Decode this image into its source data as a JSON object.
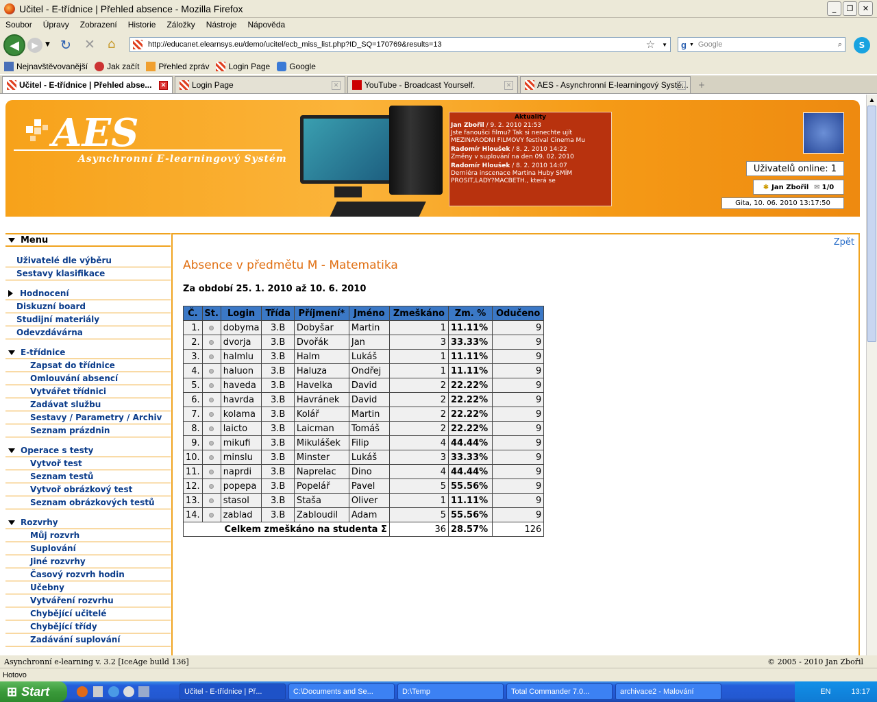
{
  "window": {
    "title": "Učitel - E-třídnice | Přehled absence - Mozilla Firefox"
  },
  "menu": [
    "Soubor",
    "Úpravy",
    "Zobrazení",
    "Historie",
    "Záložky",
    "Nástroje",
    "Nápověda"
  ],
  "url": "http://educanet.elearnsys.eu/demo/ucitel/ecb_miss_list.php?ID_SQ=170769&results=13",
  "search_placeholder": "Google",
  "bookmarks": [
    "Nejnavštěvovanější",
    "Jak začít",
    "Přehled zpráv",
    "Login Page",
    "Google"
  ],
  "tabs": [
    "Učitel - E-třídnice | Přehled abse...",
    "Login Page",
    "YouTube - Broadcast Yourself.",
    "AES - Asynchronní E-learningový Systé..."
  ],
  "header": {
    "logo": "AES",
    "subtitle": "Asynchronní E-learningový Systém",
    "news_title": "Aktuality",
    "news": [
      {
        "head": "Jan Zbořil",
        "meta": " / 9. 2. 2010 21:53",
        "text": "Jste fanoušci filmu? Tak si nenechte ujít MEZINARODNI FILMOVY festival Cinema Mu"
      },
      {
        "head": "Radomír Hloušek",
        "meta": " / 8. 2. 2010 14:22",
        "text": "Změny v suplování na den 09. 02. 2010"
      },
      {
        "head": "Radomír Hloušek",
        "meta": " / 8. 2. 2010 14:07",
        "text": "Derniéra inscenace Martina Huby SMÍM PROSIT,LADY?MACBETH., která se"
      }
    ],
    "online_label": "Uživatelů online:",
    "online_count": "1",
    "user": "Jan Zbořil",
    "user_msgs": "1/0",
    "date": "Gita, 10. 06. 2010 13:17:50"
  },
  "sidebar": {
    "menu_label": "Menu",
    "items": [
      "Uživatelé dle výběru",
      "Sestavy klasifikace",
      "Hodnocení",
      "Diskuzní board",
      "Studijní materiály",
      "Odevzdávárna",
      "E-třídnice",
      "Zapsat do třídnice",
      "Omlouvání absencí",
      "Vytvářet třídnici",
      "Zadávat službu",
      "Sestavy / Parametry / Archiv",
      "Seznam prázdnin",
      "Operace s testy",
      "Vytvoř test",
      "Seznam testů",
      "Vytvoř obrázkový test",
      "Seznam obrázkových testů",
      "Rozvrhy",
      "Můj rozvrh",
      "Suplování",
      "Jiné rozvrhy",
      "Časový rozvrh hodin",
      "Učebny",
      "Vytváření rozvrhu",
      "Chybějící učitelé",
      "Chybějící třídy",
      "Zadávání suplování"
    ]
  },
  "main": {
    "back": "Zpět",
    "title": "Absence v předmětu M - Matematika",
    "period": "Za období 25. 1. 2010 až 10. 6. 2010",
    "columns": [
      "Č.",
      "St.",
      "Login",
      "Třída",
      "Příjmení*",
      "Jméno",
      "Zmeškáno",
      "Zm. %",
      "Odučeno"
    ],
    "rows": [
      [
        "1.",
        "dobyma",
        "3.B",
        "Dobyšar",
        "Martin",
        "1",
        "11.11%",
        "9"
      ],
      [
        "2.",
        "dvorja",
        "3.B",
        "Dvořák",
        "Jan",
        "3",
        "33.33%",
        "9"
      ],
      [
        "3.",
        "halmlu",
        "3.B",
        "Halm",
        "Lukáš",
        "1",
        "11.11%",
        "9"
      ],
      [
        "4.",
        "haluon",
        "3.B",
        "Haluza",
        "Ondřej",
        "1",
        "11.11%",
        "9"
      ],
      [
        "5.",
        "haveda",
        "3.B",
        "Havelka",
        "David",
        "2",
        "22.22%",
        "9"
      ],
      [
        "6.",
        "havrda",
        "3.B",
        "Havránek",
        "David",
        "2",
        "22.22%",
        "9"
      ],
      [
        "7.",
        "kolama",
        "3.B",
        "Kolář",
        "Martin",
        "2",
        "22.22%",
        "9"
      ],
      [
        "8.",
        "laicto",
        "3.B",
        "Laicman",
        "Tomáš",
        "2",
        "22.22%",
        "9"
      ],
      [
        "9.",
        "mikufi",
        "3.B",
        "Mikulášek",
        "Filip",
        "4",
        "44.44%",
        "9"
      ],
      [
        "10.",
        "minslu",
        "3.B",
        "Minster",
        "Lukáš",
        "3",
        "33.33%",
        "9"
      ],
      [
        "11.",
        "naprdi",
        "3.B",
        "Naprelac",
        "Dino",
        "4",
        "44.44%",
        "9"
      ],
      [
        "12.",
        "popepa",
        "3.B",
        "Popelář",
        "Pavel",
        "5",
        "55.56%",
        "9"
      ],
      [
        "13.",
        "stasol",
        "3.B",
        "Staša",
        "Oliver",
        "1",
        "11.11%",
        "9"
      ],
      [
        "14.",
        "zablad",
        "3.B",
        "Zabloudil",
        "Adam",
        "5",
        "55.56%",
        "9"
      ]
    ],
    "total_label": "Celkem zmeškáno na studenta Σ",
    "total_missed": "36",
    "total_pct": "28.57%",
    "total_taught": "126"
  },
  "footer": {
    "left": "Asynchronní e-learning  v. 3.2 [IceAge build 136]",
    "right": "© 2005 - 2010  Jan Zbořil"
  },
  "status": "Hotovo",
  "taskbar": {
    "start": "Start",
    "buttons": [
      "Učitel - E-třídnice | Př...",
      "C:\\Documents and Se...",
      "D:\\Temp",
      "Total Commander 7.0...",
      "archivace2 - Malování"
    ],
    "lang": "EN",
    "clock": "13:17"
  }
}
